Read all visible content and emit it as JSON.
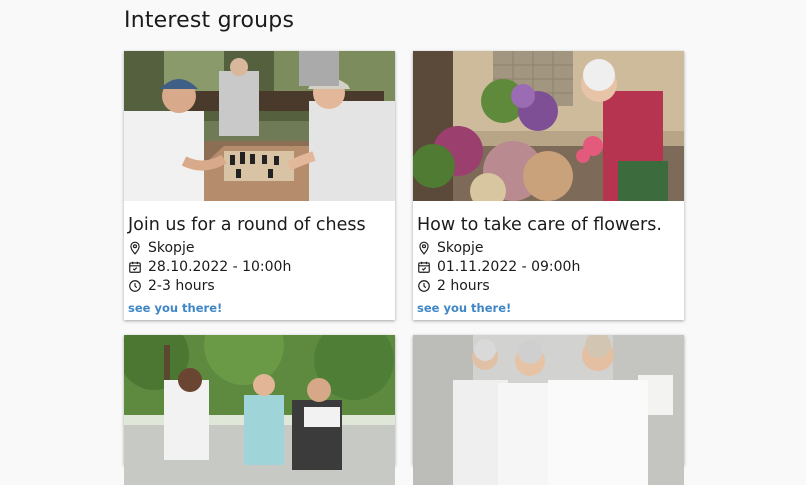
{
  "page": {
    "title": "Interest groups"
  },
  "groups": [
    {
      "title": "Join us for a round of chess",
      "location": "Skopje",
      "datetime": "28.10.2022 - 10:00h",
      "duration": "2-3 hours",
      "cta": "see you there!"
    },
    {
      "title": "How to take care of flowers.",
      "location": "Skopje",
      "datetime": "01.11.2022 - 09:00h",
      "duration": "2 hours",
      "cta": "see you there!"
    }
  ],
  "colors": {
    "link": "#3f86c7",
    "background": "#f9f9f9"
  },
  "icons": {
    "location": "map-pin-icon",
    "date": "calendar-check-icon",
    "duration": "clock-icon"
  }
}
